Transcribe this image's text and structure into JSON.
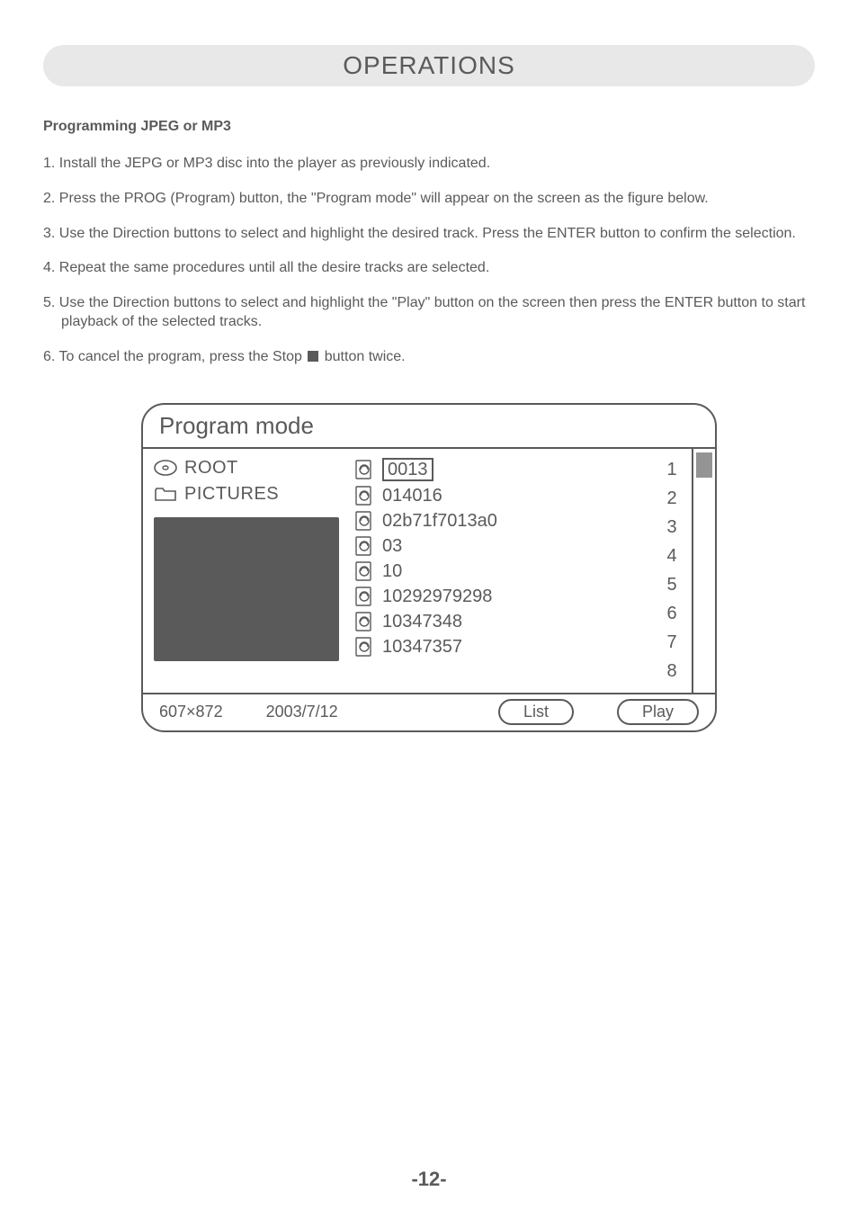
{
  "header": {
    "title": "OPERATIONS"
  },
  "section": {
    "title": "Programming JPEG or MP3"
  },
  "instructions": [
    "1. Install the JEPG or MP3 disc into the player as previously indicated.",
    "2. Press the PROG (Program) button, the \"Program mode\" will appear on the screen as the figure below.",
    "3. Use the Direction buttons to select and highlight the desired track. Press the ENTER button to confirm the selection.",
    "4. Repeat the same procedures until all the desire tracks are selected.",
    "5. Use the Direction buttons to select and highlight the \"Play\" button on the screen then press the ENTER button to start playback of the selected tracks."
  ],
  "instruction6": {
    "prefix": "6. To cancel the program, press the Stop ",
    "suffix": " button twice."
  },
  "panel": {
    "title": "Program mode",
    "tree": {
      "root": "ROOT",
      "folder": "PICTURES"
    },
    "files": [
      {
        "name": "0013",
        "selected": true
      },
      {
        "name": "014016",
        "selected": false
      },
      {
        "name": "02b71f7013a0",
        "selected": false
      },
      {
        "name": "03",
        "selected": false
      },
      {
        "name": "10",
        "selected": false
      },
      {
        "name": "10292979298",
        "selected": false
      },
      {
        "name": "10347348",
        "selected": false
      },
      {
        "name": "10347357",
        "selected": false
      }
    ],
    "numbers": [
      "1",
      "2",
      "3",
      "4",
      "5",
      "6",
      "7",
      "8"
    ],
    "footer": {
      "dimensions": "607×872",
      "date": "2003/7/12",
      "list_label": "List",
      "play_label": "Play"
    }
  },
  "page_number": "-12-"
}
